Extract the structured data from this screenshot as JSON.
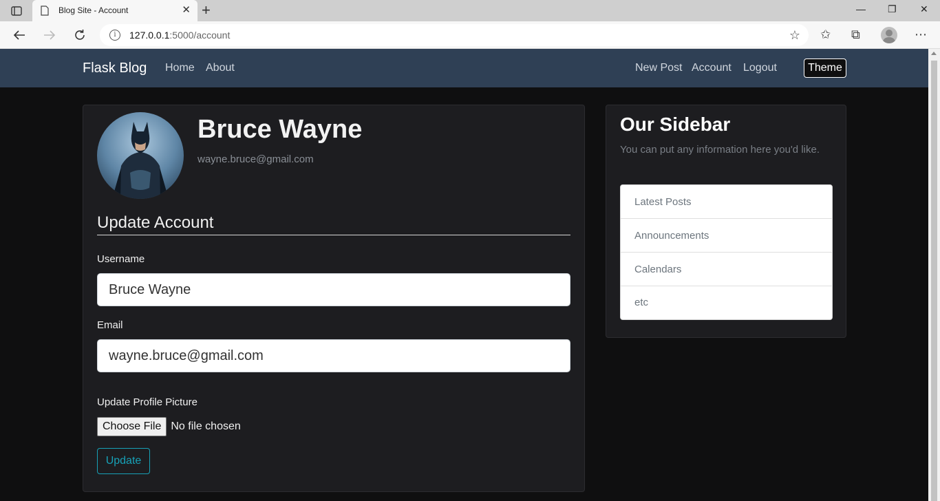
{
  "browser": {
    "tab_title": "Blog Site - Account",
    "url_host": "127.0.0.1",
    "url_path": ":5000/account",
    "new_tab": "+",
    "tab_close": "✕",
    "window": {
      "minimize": "—",
      "restore": "❐",
      "close": "✕"
    }
  },
  "navbar": {
    "brand": "Flask Blog",
    "left_links": [
      "Home",
      "About"
    ],
    "right_links": [
      "New Post",
      "Account",
      "Logout"
    ],
    "theme_button": "Theme"
  },
  "profile": {
    "name": "Bruce Wayne",
    "email": "wayne.bruce@gmail.com"
  },
  "form": {
    "legend": "Update Account",
    "username_label": "Username",
    "username_value": "Bruce Wayne",
    "email_label": "Email",
    "email_value": "wayne.bruce@gmail.com",
    "picture_label": "Update Profile Picture",
    "file_button": "Choose File",
    "file_status": "No file chosen",
    "submit": "Update"
  },
  "sidebar": {
    "title": "Our Sidebar",
    "description": "You can put any information here you'd like.",
    "items": [
      "Latest Posts",
      "Announcements",
      "Calendars",
      "etc"
    ]
  },
  "colors": {
    "navbar": "#2f4055",
    "page_bg": "#0f0f10",
    "card_bg": "#1d1d20",
    "accent": "#17a2b8"
  }
}
